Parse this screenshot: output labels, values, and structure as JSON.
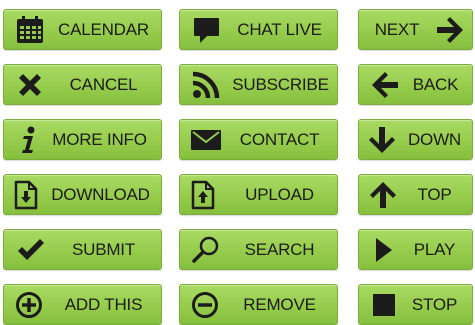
{
  "buttons": {
    "calendar": "CALENDAR",
    "chat_live": "CHAT LIVE",
    "next": "NEXT",
    "cancel": "CANCEL",
    "subscribe": "SUBSCRIBE",
    "back": "BACK",
    "more_info": "MORE INFO",
    "contact": "CONTACT",
    "down": "DOWN",
    "download": "DOWNLOAD",
    "upload": "UPLOAD",
    "top": "TOP",
    "submit": "SUBMIT",
    "search": "SEARCH",
    "play": "PLAY",
    "add_this": "ADD THIS",
    "remove": "REMOVE",
    "stop": "STOP"
  },
  "icons": {
    "calendar": "calendar-icon",
    "chat_live": "chat-bubble-icon",
    "next": "arrow-right-icon",
    "cancel": "x-icon",
    "subscribe": "rss-icon",
    "back": "arrow-left-icon",
    "more_info": "info-i-icon",
    "contact": "envelope-icon",
    "down": "arrow-down-icon",
    "download": "download-file-icon",
    "upload": "upload-file-icon",
    "top": "arrow-up-icon",
    "submit": "checkmark-icon",
    "search": "magnifier-icon",
    "play": "play-triangle-icon",
    "add_this": "plus-circle-icon",
    "remove": "minus-circle-icon",
    "stop": "stop-square-icon"
  },
  "colors": {
    "button_fill_top": "#a9da64",
    "button_fill_bottom": "#86bf3d",
    "button_border": "#7cad3b",
    "text_and_icon": "#1c1c1c",
    "background": "#ffffff"
  }
}
